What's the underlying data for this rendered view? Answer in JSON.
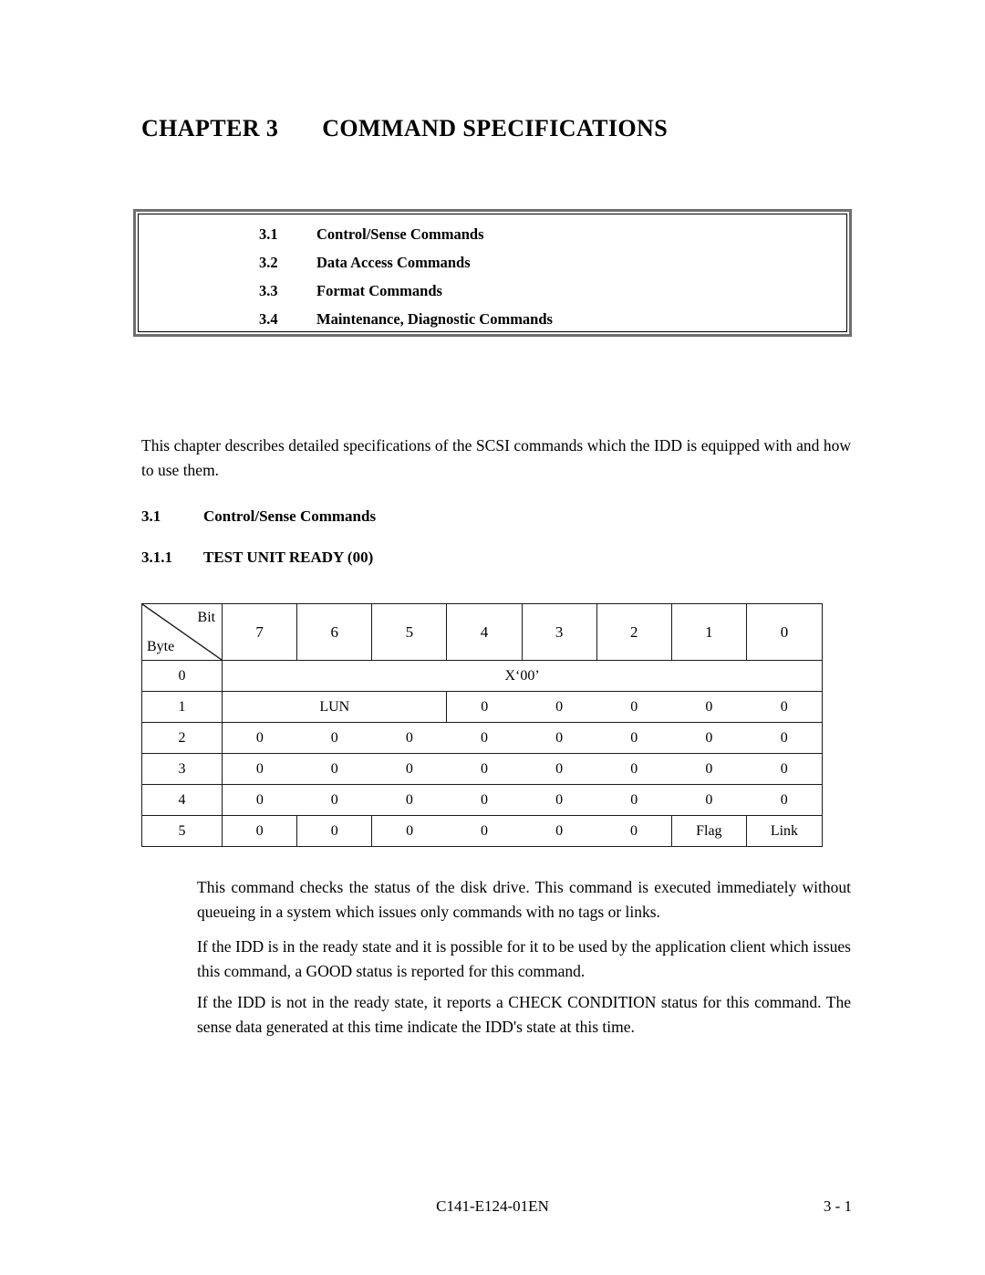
{
  "chapter": {
    "label": "CHAPTER 3",
    "title": "COMMAND SPECIFICATIONS"
  },
  "toc": {
    "items": [
      {
        "number": "3.1",
        "label": "Control/Sense Commands"
      },
      {
        "number": "3.2",
        "label": "Data Access Commands"
      },
      {
        "number": "3.3",
        "label": "Format Commands"
      },
      {
        "number": "3.4",
        "label": "Maintenance, Diagnostic Commands"
      }
    ]
  },
  "intro": "This chapter describes detailed specifications of the SCSI commands which the IDD is equipped with and how to use them.",
  "headings": {
    "section": {
      "number": "3.1",
      "text": "Control/Sense Commands"
    },
    "subsection": {
      "number": "3.1.1",
      "text": "TEST UNIT READY (00)"
    }
  },
  "cdb_table": {
    "corner": {
      "bit_label": "Bit",
      "byte_label": "Byte"
    },
    "bit_headers": [
      "7",
      "6",
      "5",
      "4",
      "3",
      "2",
      "1",
      "0"
    ],
    "rows": [
      {
        "byte": "0",
        "cells": [
          "X‘00’"
        ]
      },
      {
        "byte": "1",
        "cells": [
          "LUN",
          "0",
          "0",
          "0",
          "0",
          "0"
        ]
      },
      {
        "byte": "2",
        "cells": [
          "0",
          "0",
          "0",
          "0",
          "0",
          "0",
          "0",
          "0"
        ]
      },
      {
        "byte": "3",
        "cells": [
          "0",
          "0",
          "0",
          "0",
          "0",
          "0",
          "0",
          "0"
        ]
      },
      {
        "byte": "4",
        "cells": [
          "0",
          "0",
          "0",
          "0",
          "0",
          "0",
          "0",
          "0"
        ]
      },
      {
        "byte": "5",
        "cells": [
          "0",
          "0",
          "0",
          "0",
          "0",
          "0",
          "Flag",
          "Link"
        ]
      }
    ]
  },
  "paragraphs": {
    "p1": "This command checks the status of the disk drive. This command is executed immediately without queueing in a system which issues only commands with no tags or links.",
    "p2": "If the IDD is in the ready state and it is possible for it to be used by the application client which issues   this command, a GOOD status is reported for this command.",
    "p3": "If the IDD is not in the ready state, it reports a CHECK CONDITION status for this command. The sense data generated at this time indicate the IDD's state at this time."
  },
  "footer": {
    "document_number": "C141-E124-01EN",
    "page_number": "3 - 1"
  }
}
